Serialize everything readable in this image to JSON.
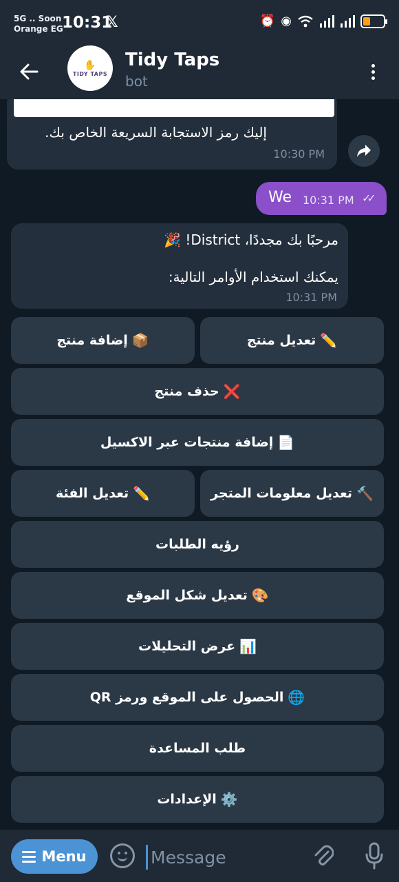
{
  "status": {
    "carrier_line1": "5G .. Soon",
    "carrier_line2": "Orange EG",
    "time": "10:31",
    "x_icon": "x-logo-icon"
  },
  "header": {
    "bot_name": "Tidy Taps",
    "bot_status": "bot",
    "avatar_text": "TIDY TAPS"
  },
  "messages": {
    "qr_message": "إليك رمز الاستجابة السريعة الخاص بك.",
    "qr_time": "10:30 PM",
    "outgoing_text": "We",
    "outgoing_time": "10:31 PM",
    "welcome_line1": "مرحبًا بك مجددًا، District! 🎉",
    "welcome_line2": "يمكنك استخدام الأوامر التالية:",
    "welcome_time": "10:31 PM"
  },
  "keyboard": {
    "edit_product": "تعديل منتج",
    "add_product": "إضافة منتج",
    "delete_product": "حذف منتج",
    "add_excel": "إضافة منتجات عبر الاكسيل",
    "edit_store": "تعديل معلومات المتجر",
    "edit_category": "تعديل الفئة",
    "view_orders": "رؤيه الطلبات",
    "edit_site_look": "تعديل شكل الموقع",
    "analytics": "عرض التحليلات",
    "get_site_qr": "الحصول على الموقع ورمز QR",
    "help": "طلب المساعدة",
    "settings": "الإعدادات"
  },
  "input": {
    "menu_label": "Menu",
    "placeholder": "Message"
  },
  "colors": {
    "accent": "#4c93d6",
    "outgoing_bubble": "#8a4fc9",
    "incoming_bubble": "#242f3d",
    "keyboard_button": "#2b3846"
  }
}
